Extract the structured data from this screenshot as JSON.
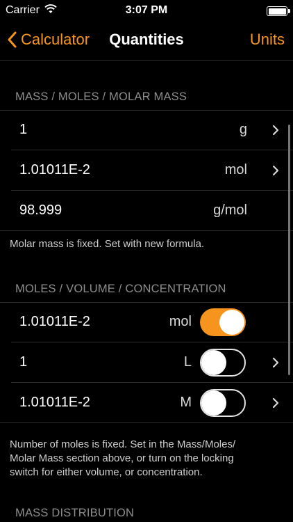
{
  "status": {
    "carrier": "Carrier",
    "time": "3:07 PM"
  },
  "nav": {
    "back_label": "Calculator",
    "title": "Quantities",
    "right_label": "Units"
  },
  "sections": [
    {
      "header": "MASS / MOLES / MOLAR MASS",
      "rows": [
        {
          "value": "1",
          "unit": "g"
        },
        {
          "value": "1.01011E-2",
          "unit": "mol"
        },
        {
          "value": "98.999",
          "unit": "g/mol"
        }
      ],
      "footer": "Molar mass is fixed. Set with new formula."
    },
    {
      "header": "MOLES / VOLUME / CONCENTRATION",
      "rows": [
        {
          "value": "1.01011E-2",
          "unit": "mol",
          "lock": true
        },
        {
          "value": "1",
          "unit": "L",
          "lock": false
        },
        {
          "value": "1.01011E-2",
          "unit": "M",
          "lock": false
        }
      ],
      "footer": [
        "Number of moles is fixed. Set in the Mass/Moles/",
        "Molar Mass section above, or turn on the locking",
        "switch for either volume, or concentration."
      ]
    },
    {
      "header": "MASS DISTRIBUTION"
    }
  ],
  "colors": {
    "accent": "#f7941d",
    "background": "#000000",
    "separator": "#2c2c2c"
  }
}
